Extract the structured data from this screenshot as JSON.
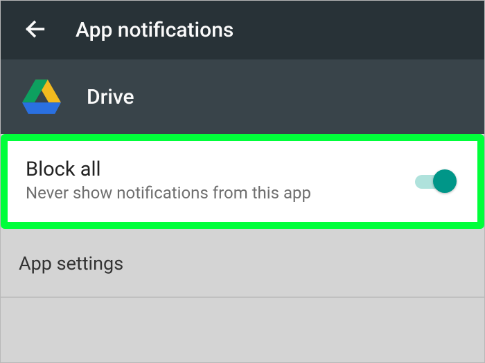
{
  "appbar": {
    "title": "App notifications"
  },
  "app": {
    "name": "Drive"
  },
  "block_all": {
    "title": "Block all",
    "subtitle": "Never show notifications from this app",
    "enabled": true
  },
  "app_settings": {
    "title": "App settings"
  },
  "colors": {
    "accent": "#009688",
    "highlight": "#00ff3a"
  }
}
